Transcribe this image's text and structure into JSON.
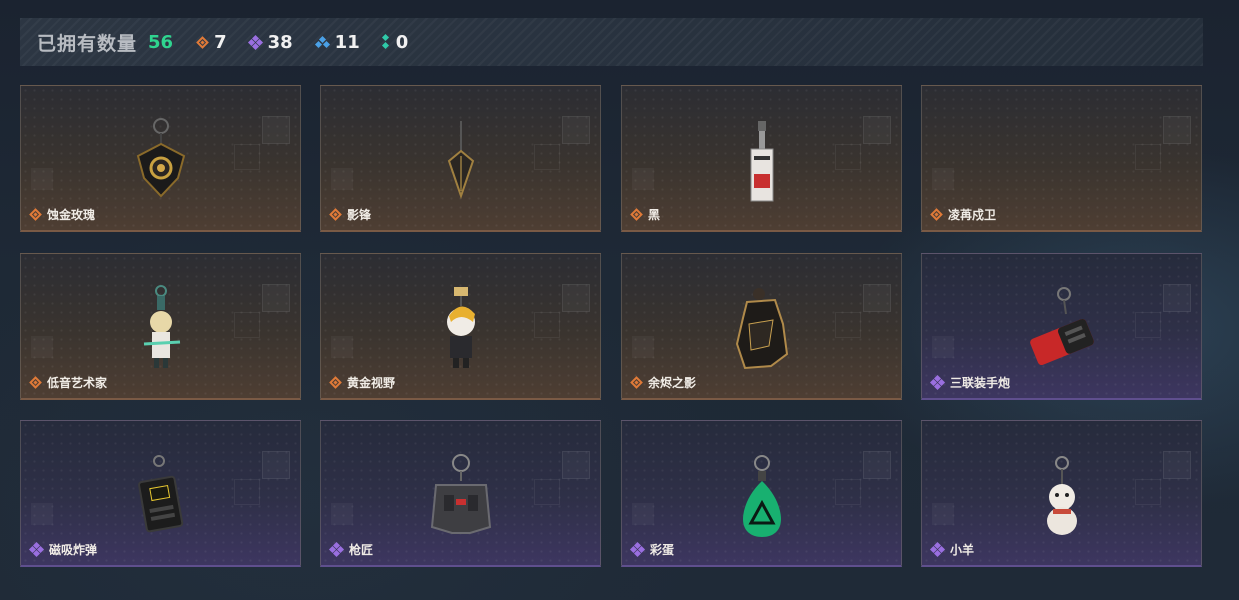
{
  "header": {
    "title": "已拥有数量",
    "total": "56",
    "stats": [
      {
        "icon": "orange-diamond-icon",
        "value": "7"
      },
      {
        "icon": "purple-cluster-icon",
        "value": "38"
      },
      {
        "icon": "blue-cluster-icon",
        "value": "11"
      },
      {
        "icon": "green-dots-icon",
        "value": "0"
      }
    ]
  },
  "colors": {
    "accent_total": "#2fd48f",
    "rarity_orange": "#e07a38",
    "rarity_purple": "#9a6fe0",
    "rarity_blue": "#4aa0e6",
    "rarity_green": "#2fc9a8"
  },
  "items": [
    {
      "name": "蚀金玫瑰",
      "rarity": "orange"
    },
    {
      "name": "影锋",
      "rarity": "orange"
    },
    {
      "name": "黑",
      "rarity": "orange"
    },
    {
      "name": "凌苒戍卫",
      "rarity": "orange"
    },
    {
      "name": "低音艺术家",
      "rarity": "orange"
    },
    {
      "name": "黄金视野",
      "rarity": "orange"
    },
    {
      "name": "余烬之影",
      "rarity": "orange"
    },
    {
      "name": "三联装手炮",
      "rarity": "purple"
    },
    {
      "name": "磁吸炸弹",
      "rarity": "purple"
    },
    {
      "name": "枪匠",
      "rarity": "purple"
    },
    {
      "name": "彩蛋",
      "rarity": "purple"
    },
    {
      "name": "小羊",
      "rarity": "purple"
    }
  ]
}
